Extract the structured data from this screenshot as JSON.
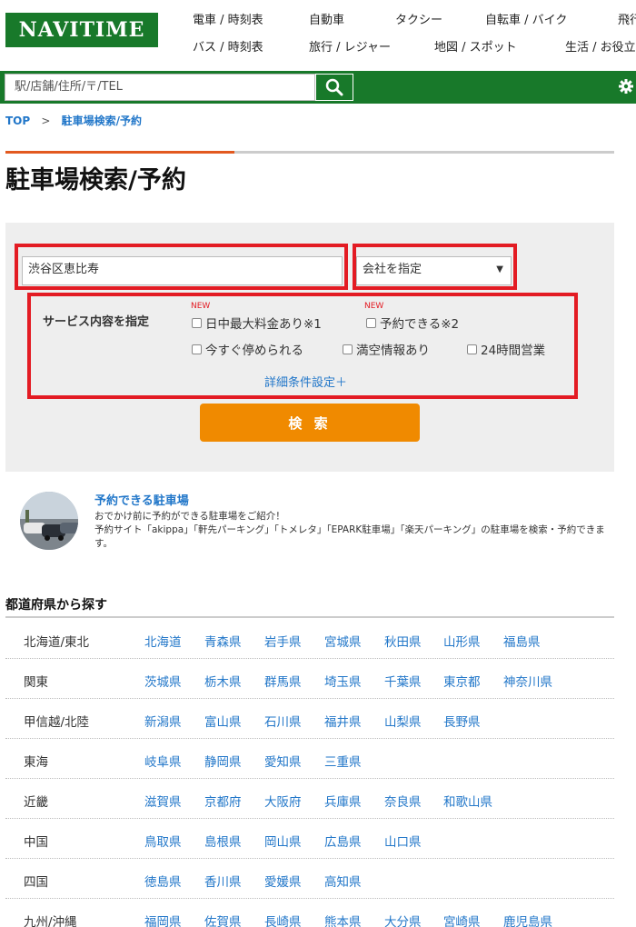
{
  "header": {
    "logo": "NAVITIME",
    "nav_row1": [
      "電車 / 時刻表",
      "自動車",
      "タクシー",
      "自転車 / バイク",
      "飛行"
    ],
    "nav_row2": [
      "バス / 時刻表",
      "旅行 / レジャー",
      "地図 / スポット",
      "生活 / お役立"
    ]
  },
  "search": {
    "placeholder": "駅/店舗/住所/〒/TEL"
  },
  "breadcrumb": {
    "home": "TOP",
    "sep": ">",
    "current": "駐車場検索/予約"
  },
  "page_title": "駐車場検索/予約",
  "form": {
    "location_value": "渋谷区恵比寿",
    "company_select": "会社を指定",
    "service_label": "サービス内容を指定",
    "new_tag": "NEW",
    "options": [
      "日中最大料金あり※1",
      "予約できる※2",
      "今すぐ停められる",
      "満空情報あり",
      "24時間営業"
    ],
    "detail_link": "詳細条件設定＋",
    "search_button": "検 索"
  },
  "promo": {
    "title": "予約できる駐車場",
    "line1": "おでかけ前に予約ができる駐車場をご紹介！",
    "line2": "予約サイト「akippa」「軒先パーキング」「トメレタ」「EPARK駐車場」「楽天パーキング」の駐車場を検索・予約できます。"
  },
  "prefectures": {
    "heading": "都道府県から探す",
    "regions": [
      {
        "name": "北海道/東北",
        "prefs": [
          "北海道",
          "青森県",
          "岩手県",
          "宮城県",
          "秋田県",
          "山形県",
          "福島県"
        ]
      },
      {
        "name": "関東",
        "prefs": [
          "茨城県",
          "栃木県",
          "群馬県",
          "埼玉県",
          "千葉県",
          "東京都",
          "神奈川県"
        ]
      },
      {
        "name": "甲信越/北陸",
        "prefs": [
          "新潟県",
          "富山県",
          "石川県",
          "福井県",
          "山梨県",
          "長野県"
        ]
      },
      {
        "name": "東海",
        "prefs": [
          "岐阜県",
          "静岡県",
          "愛知県",
          "三重県"
        ]
      },
      {
        "name": "近畿",
        "prefs": [
          "滋賀県",
          "京都府",
          "大阪府",
          "兵庫県",
          "奈良県",
          "和歌山県"
        ]
      },
      {
        "name": "中国",
        "prefs": [
          "鳥取県",
          "島根県",
          "岡山県",
          "広島県",
          "山口県"
        ]
      },
      {
        "name": "四国",
        "prefs": [
          "徳島県",
          "香川県",
          "愛媛県",
          "高知県"
        ]
      },
      {
        "name": "九州/沖縄",
        "prefs": [
          "福岡県",
          "佐賀県",
          "長崎県",
          "熊本県",
          "大分県",
          "宮崎県",
          "鹿児島県"
        ]
      }
    ]
  },
  "colors": {
    "brand_green": "#18792a",
    "accent_orange": "#f08a00",
    "highlight_red": "#e31b23",
    "link_blue": "#2277c9"
  }
}
